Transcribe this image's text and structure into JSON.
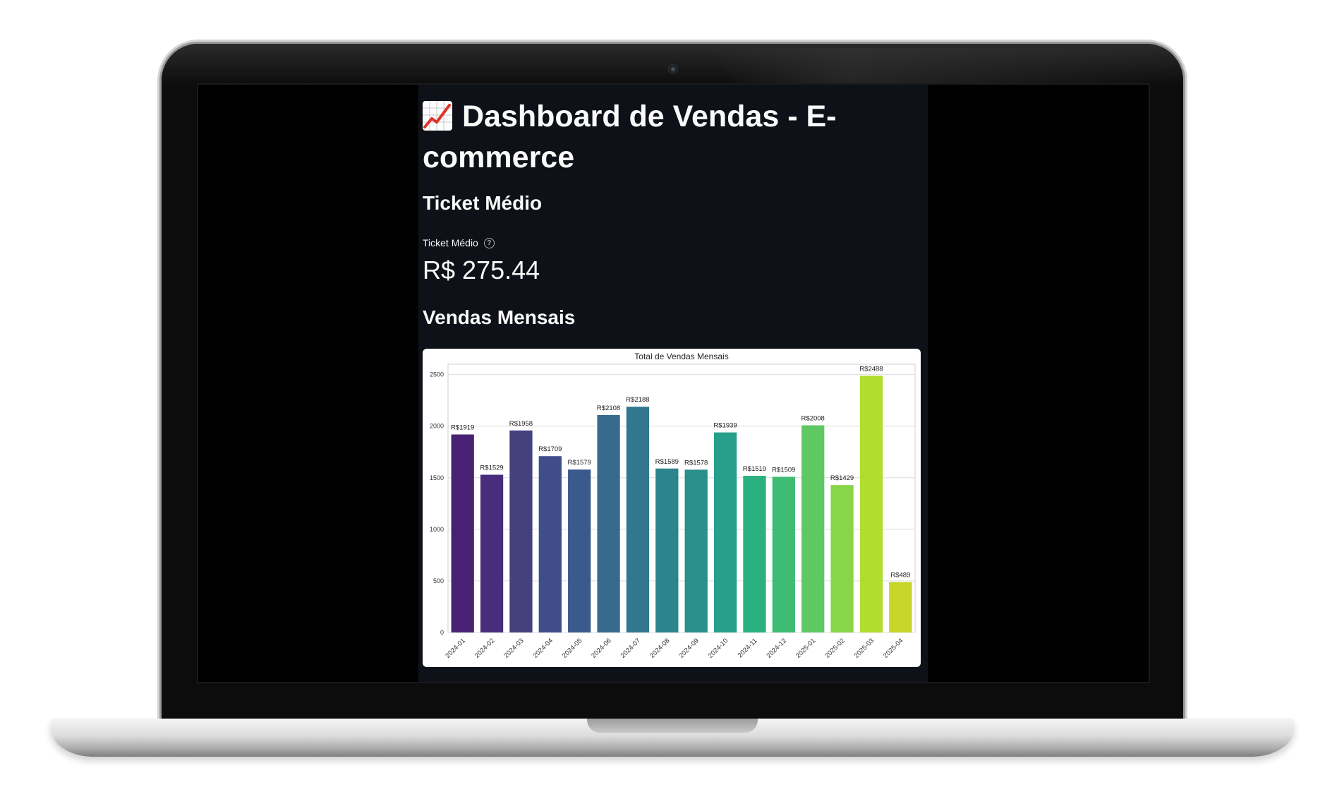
{
  "app": {
    "title": "Dashboard de Vendas - E-commerce",
    "title_icon": "chart-increasing-icon"
  },
  "ticket_section": {
    "heading": "Ticket Médio",
    "metric_label": "Ticket Médio",
    "metric_value": "R$ 275.44",
    "help_icon": "question-circle-icon"
  },
  "sales_section": {
    "heading": "Vendas Mensais"
  },
  "chart_data": {
    "type": "bar",
    "title": "Total de Vendas Mensais",
    "xlabel": "",
    "ylabel": "",
    "ylim": [
      0,
      2600
    ],
    "yticks": [
      0,
      500,
      1000,
      1500,
      2000,
      2500
    ],
    "grid": true,
    "categories": [
      "2024-01",
      "2024-02",
      "2024-03",
      "2024-04",
      "2024-05",
      "2024-06",
      "2024-07",
      "2024-08",
      "2024-09",
      "2024-10",
      "2024-11",
      "2024-12",
      "2025-01",
      "2025-02",
      "2025-03",
      "2025-04"
    ],
    "values": [
      1919,
      1529,
      1958,
      1709,
      1579,
      2108,
      2188,
      1589,
      1578,
      1939,
      1519,
      1509,
      2008,
      1429,
      2488,
      489
    ],
    "labels": [
      "R$1919",
      "R$1529",
      "R$1958",
      "R$1709",
      "R$1579",
      "R$2108",
      "R$2188",
      "R$1589",
      "R$1578",
      "R$1939",
      "R$1519",
      "R$1509",
      "R$2008",
      "R$1429",
      "R$2488",
      "R$489"
    ],
    "colors": [
      "#482172",
      "#472d7b",
      "#44417f",
      "#3f4d8a",
      "#3b5a8c",
      "#366b8d",
      "#31778e",
      "#2c848d",
      "#29908c",
      "#26a08a",
      "#2bb07f",
      "#3fbc73",
      "#5ec863",
      "#88d54a",
      "#b1dd2f",
      "#c7d52a"
    ]
  }
}
